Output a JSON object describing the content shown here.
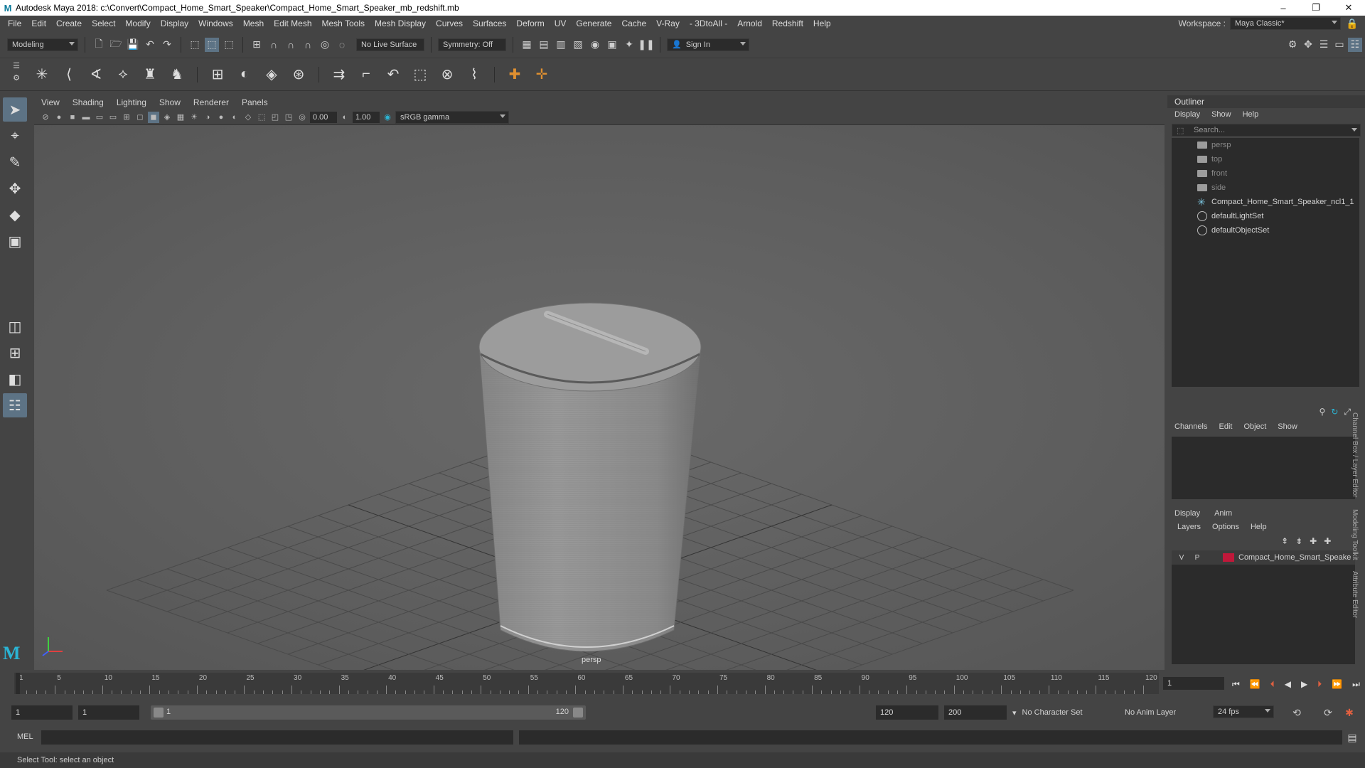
{
  "window": {
    "title": "Autodesk Maya 2018: c:\\Convert\\Compact_Home_Smart_Speaker\\Compact_Home_Smart_Speaker_mb_redshift.mb",
    "minimize": "–",
    "maximize": "❐",
    "close": "✕"
  },
  "menubar": {
    "items": [
      "File",
      "Edit",
      "Create",
      "Select",
      "Modify",
      "Display",
      "Windows",
      "Mesh",
      "Edit Mesh",
      "Mesh Tools",
      "Mesh Display",
      "Curves",
      "Surfaces",
      "Deform",
      "UV",
      "Generate",
      "Cache",
      "V-Ray",
      "- 3DtoAll -",
      "Arnold",
      "Redshift",
      "Help"
    ],
    "workspace_label": "Workspace :",
    "workspace_value": "Maya Classic*"
  },
  "statusline": {
    "mode": "Modeling",
    "live_surface": "No Live Surface",
    "symmetry": "Symmetry: Off",
    "sign_in": "Sign In"
  },
  "viewport": {
    "menu": [
      "View",
      "Shading",
      "Lighting",
      "Show",
      "Renderer",
      "Panels"
    ],
    "exposure": "0.00",
    "gamma": "1.00",
    "color_space": "sRGB gamma",
    "camera": "persp"
  },
  "outliner": {
    "title": "Outliner",
    "menu": [
      "Display",
      "Show",
      "Help"
    ],
    "search_placeholder": "Search...",
    "items": [
      {
        "label": "persp",
        "icon": "camera-icon",
        "dim": true
      },
      {
        "label": "top",
        "icon": "camera-icon",
        "dim": true
      },
      {
        "label": "front",
        "icon": "camera-icon",
        "dim": true
      },
      {
        "label": "side",
        "icon": "camera-icon",
        "dim": true
      },
      {
        "label": "Compact_Home_Smart_Speaker_ncl1_1",
        "icon": "transform-icon",
        "dim": false
      },
      {
        "label": "defaultLightSet",
        "icon": "set-icon",
        "dim": false
      },
      {
        "label": "defaultObjectSet",
        "icon": "set-icon",
        "dim": false
      }
    ]
  },
  "channelbox": {
    "menu": [
      "Channels",
      "Edit",
      "Object",
      "Show"
    ]
  },
  "layereditor": {
    "tabs": [
      "Display",
      "Anim"
    ],
    "menu": [
      "Layers",
      "Options",
      "Help"
    ],
    "layer": {
      "v": "V",
      "p": "P",
      "name": "Compact_Home_Smart_Speake",
      "color": "#c0183a"
    }
  },
  "side_tabs": [
    "Channel Box / Layer Editor",
    "Modeling Toolkit",
    "Attribute Editor"
  ],
  "timeline": {
    "ticks": [
      1,
      5,
      10,
      15,
      20,
      25,
      30,
      35,
      40,
      45,
      50,
      55,
      60,
      65,
      70,
      75,
      80,
      85,
      90,
      95,
      100,
      105,
      110,
      115,
      120
    ],
    "current_frame": "1"
  },
  "range": {
    "start": "1",
    "inner_start": "1",
    "slider_start": "1",
    "slider_end": "120",
    "end": "120",
    "outer_end": "200",
    "character_set": "No Character Set",
    "anim_layer": "No Anim Layer",
    "fps": "24 fps"
  },
  "cmdline": {
    "label": "MEL"
  },
  "helpline": {
    "text": "Select Tool: select an object"
  }
}
